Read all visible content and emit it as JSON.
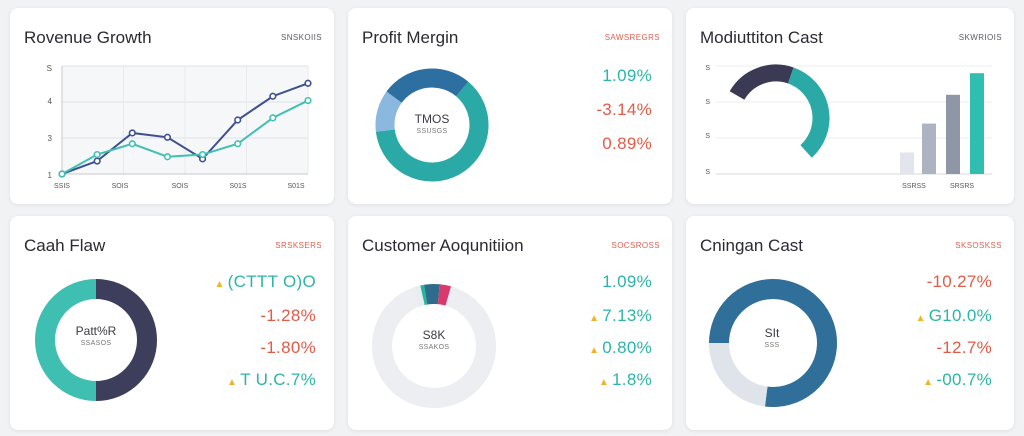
{
  "cards": {
    "revenue_growth": {
      "title": "Rovenue Growth",
      "tag": "SNSKOIIS",
      "y_ticks": [
        "S",
        "4",
        "3",
        "1"
      ],
      "x_ticks": [
        "SSIS",
        "SOIS",
        "SOIS",
        "S01S",
        "S01S"
      ]
    },
    "profit_margin": {
      "title": "Profit Mergin",
      "tag": "SAWSREGRS",
      "center_big": "TMOS",
      "center_small": "SSUSGS",
      "metrics": [
        "1.09%",
        "-3.14%",
        "0.89%"
      ]
    },
    "modulation_cost": {
      "title": "Modiuttiton Cast",
      "tag": "SKWRIOIS",
      "y_ticks": [
        "S",
        "S",
        "S",
        "S"
      ],
      "x_ticks": [
        "SSRSS",
        "SRSRS"
      ]
    },
    "cash_flow": {
      "title": "Caah Flaw",
      "tag": "SRSKSERS",
      "center_big": "Patt%R",
      "center_small": "SSASOS",
      "metrics": [
        "(CTTT O)O",
        "-1.28%",
        "-1.80%",
        "T U.C.7%"
      ]
    },
    "customer_acquisition": {
      "title": "Customer Aoqunitiion",
      "tag": "SOCSROSS",
      "center_big": "S8K",
      "center_small": "SSAKOS",
      "metrics": [
        "1.09%",
        "7.13%",
        "0.80%",
        "1.8%"
      ]
    },
    "chingan_cost": {
      "title": "Cningan Cast",
      "tag": "SKSOSKSS",
      "center_big": "SIt",
      "center_small": "SSS",
      "metrics": [
        "-10.27%",
        "G10.0%",
        "-12.7%",
        "-00.7%"
      ]
    }
  },
  "chart_data": [
    {
      "type": "line",
      "title": "Rovenue Growth",
      "x": [
        0,
        1,
        2,
        3,
        4,
        5,
        6,
        7
      ],
      "series": [
        {
          "values": [
            1.0,
            1.6,
            2.9,
            2.7,
            1.7,
            3.5,
            4.6,
            5.2
          ],
          "color": "#3d4f8f"
        },
        {
          "values": [
            1.0,
            1.9,
            2.4,
            1.8,
            1.9,
            2.4,
            3.6,
            4.4
          ],
          "color": "#3fc0b3"
        }
      ],
      "ylim": [
        1,
        6
      ],
      "grid": true
    },
    {
      "type": "pie",
      "title": "Profit Mergin",
      "slices": [
        {
          "value": 62,
          "color": "#2aa9a6"
        },
        {
          "value": 12,
          "color": "#8bb8df"
        },
        {
          "value": 26,
          "color": "#2e6fa1"
        }
      ],
      "remainder_color": "#e9ecf2"
    },
    {
      "type": "bar",
      "title": "Modiuttiton Cast",
      "values": [
        1.2,
        2.8,
        4.4,
        5.6
      ],
      "colors": [
        "#e3e5ee",
        "#aeb3c2",
        "#8f96a6",
        "#2fbeb0"
      ],
      "ylim": [
        0,
        6
      ],
      "donut": [
        {
          "value": 33,
          "color": "#2aa9a6"
        },
        {
          "value": 22,
          "color": "#3a3a55"
        }
      ]
    },
    {
      "type": "pie",
      "title": "Caah Flaw",
      "slices": [
        {
          "value": 50,
          "color": "#3fbfb1"
        },
        {
          "value": 50,
          "color": "#3c3e5c"
        }
      ]
    },
    {
      "type": "pie",
      "title": "Customer Aoqunitiion",
      "slices": [
        {
          "value": 2,
          "color": "#e9ecf0"
        },
        {
          "value": 1,
          "color": "#23b79b"
        },
        {
          "value": 4,
          "color": "#2f6b8c"
        },
        {
          "value": 3,
          "color": "#d93a6e"
        },
        {
          "value": 90,
          "color": "#eceef1"
        }
      ]
    },
    {
      "type": "pie",
      "title": "Cningan Cast",
      "slices": [
        {
          "value": 52,
          "color": "#2f6f99"
        },
        {
          "value": 23,
          "color": "#dfe3ea"
        },
        {
          "value": 25,
          "color": "#2f6f99"
        }
      ]
    }
  ]
}
